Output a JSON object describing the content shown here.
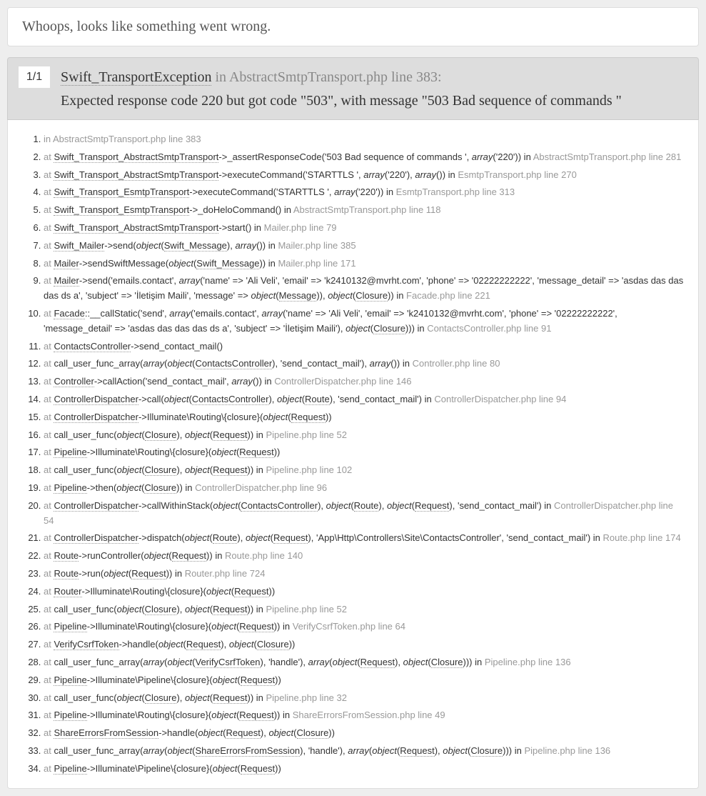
{
  "whoops_title": "Whoops, looks like something went wrong.",
  "counter": "1/1",
  "exception": {
    "name": "Swift_TransportException",
    "in_word": "in",
    "location": "AbstractSmtpTransport.php line 383",
    "message": "Expected response code 220 but got code \"503\", with message \"503 Bad sequence of commands \""
  },
  "t": {
    "in": "in ",
    "at": "at ",
    "obj": "object",
    "arr": "array",
    "l1_loc": "AbstractSmtpTransport.php line 383",
    "l2_cls": "Swift_Transport_AbstractSmtpTransport",
    "l2_m": "->_assertResponseCode('503 Bad sequence of commands ', ",
    "l2_a2": "('220')) in ",
    "l2_loc": "AbstractSmtpTransport.php line 281",
    "l3_cls": "Swift_Transport_AbstractSmtpTransport",
    "l3_m": "->executeCommand('STARTTLS ', ",
    "l3_a1": "('220'), ",
    "l3_a2": "()) in ",
    "l3_loc": "EsmtpTransport.php line 270",
    "l4_cls": "Swift_Transport_EsmtpTransport",
    "l4_m": "->executeCommand('STARTTLS ', ",
    "l4_a1": "('220')) in ",
    "l4_loc": "EsmtpTransport.php line 313",
    "l5_cls": "Swift_Transport_EsmtpTransport",
    "l5_m": "->_doHeloCommand() in ",
    "l5_loc": "AbstractSmtpTransport.php line 118",
    "l6_cls": "Swift_Transport_AbstractSmtpTransport",
    "l6_m": "->start() in ",
    "l6_loc": "Mailer.php line 79",
    "l7_cls": "Swift_Mailer",
    "l7_m": "->send(",
    "l7_o": "Swift_Message",
    "l7_t": "()) in ",
    "l7_loc": "Mailer.php line 385",
    "l8_cls": "Mailer",
    "l8_m": "->sendSwiftMessage(",
    "l8_o": "Swift_Message",
    "l8_t": ")) in ",
    "l8_loc": "Mailer.php line 171",
    "l9_cls": "Mailer",
    "l9_m": "->send('emails.contact', ",
    "l9_a": "('name' => 'Ali Veli', 'email' => 'k2410132@mvrht.com', 'phone' => '02222222222', 'message_detail' => 'asdas das das das ds a', 'subject' => 'İletişim Maili', 'message' => ",
    "l9_o1": "Message",
    "l9_t1": ")), ",
    "l9_o2": "Closure",
    "l9_t2": ")) in ",
    "l9_loc": "Facade.php line 221",
    "l10_cls": "Facade",
    "l10_m": "::__callStatic('send', ",
    "l10_a1": "('emails.contact', ",
    "l10_a2": "('name' => 'Ali Veli', 'email' => 'k2410132@mvrht.com', 'phone' => '02222222222', 'message_detail' => 'asdas das das das ds a', 'subject' => 'İletişim Maili'), ",
    "l10_o": "Closure",
    "l10_t": "))) in ",
    "l10_loc": "ContactsController.php line 91",
    "l11_cls": "ContactsController",
    "l11_m": "->send_contact_mail()",
    "l12_pre": "call_user_func_array(",
    "l12_o": "ContactsController",
    "l12_t1": "), 'send_contact_mail'), ",
    "l12_t2": "()) in ",
    "l12_loc": "Controller.php line 80",
    "l13_cls": "Controller",
    "l13_m": "->callAction('send_contact_mail', ",
    "l13_t": "()) in ",
    "l13_loc": "ControllerDispatcher.php line 146",
    "l14_cls": "ControllerDispatcher",
    "l14_m": "->call(",
    "l14_o1": "ContactsController",
    "l14_t1": "), ",
    "l14_o2": "Route",
    "l14_t2": "), 'send_contact_mail') in ",
    "l14_loc": "ControllerDispatcher.php line 94",
    "l15_cls": "ControllerDispatcher",
    "l15_m": "->Illuminate\\Routing\\{closure}(",
    "l15_o": "Request",
    "l15_t": "))",
    "l16_pre": "call_user_func(",
    "l16_o1": "Closure",
    "l16_o2": "Request",
    "l16_t": ")) in ",
    "l16_loc": "Pipeline.php line 52",
    "l17_cls": "Pipeline",
    "l17_m": "->Illuminate\\Routing\\{closure}(",
    "l17_o": "Request",
    "l17_t": "))",
    "l18_pre": "call_user_func(",
    "l18_o1": "Closure",
    "l18_o2": "Request",
    "l18_t": ")) in ",
    "l18_loc": "Pipeline.php line 102",
    "l19_cls": "Pipeline",
    "l19_m": "->then(",
    "l19_o": "Closure",
    "l19_t": ")) in ",
    "l19_loc": "ControllerDispatcher.php line 96",
    "l20_cls": "ControllerDispatcher",
    "l20_m": "->callWithinStack(",
    "l20_o1": "ContactsController",
    "l20_o2": "Route",
    "l20_o3": "Request",
    "l20_t": "), 'send_contact_mail') in ",
    "l20_loc": "ControllerDispatcher.php line 54",
    "l21_cls": "ControllerDispatcher",
    "l21_m": "->dispatch(",
    "l21_o1": "Route",
    "l21_o2": "Request",
    "l21_t": "), 'App\\Http\\Controllers\\Site\\ContactsController', 'send_contact_mail') in ",
    "l21_loc": "Route.php line 174",
    "l22_cls": "Route",
    "l22_m": "->runController(",
    "l22_o": "Request",
    "l22_t": ")) in ",
    "l22_loc": "Route.php line 140",
    "l23_cls": "Route",
    "l23_m": "->run(",
    "l23_o": "Request",
    "l23_t": ")) in ",
    "l23_loc": "Router.php line 724",
    "l24_cls": "Router",
    "l24_m": "->Illuminate\\Routing\\{closure}(",
    "l24_o": "Request",
    "l24_t": "))",
    "l25_pre": "call_user_func(",
    "l25_o1": "Closure",
    "l25_o2": "Request",
    "l25_t": ")) in ",
    "l25_loc": "Pipeline.php line 52",
    "l26_cls": "Pipeline",
    "l26_m": "->Illuminate\\Routing\\{closure}(",
    "l26_o": "Request",
    "l26_t": ")) in ",
    "l26_loc": "VerifyCsrfToken.php line 64",
    "l27_cls": "VerifyCsrfToken",
    "l27_m": "->handle(",
    "l27_o1": "Request",
    "l27_o2": "Closure",
    "l27_t": "))",
    "l28_pre": "call_user_func_array(",
    "l28_o1": "VerifyCsrfToken",
    "l28_t1": "), 'handle'), ",
    "l28_o2": "Request",
    "l28_o3": "Closure",
    "l28_t2": "))) in ",
    "l28_loc": "Pipeline.php line 136",
    "l29_cls": "Pipeline",
    "l29_m": "->Illuminate\\Pipeline\\{closure}(",
    "l29_o": "Request",
    "l29_t": "))",
    "l30_pre": "call_user_func(",
    "l30_o1": "Closure",
    "l30_o2": "Request",
    "l30_t": ")) in ",
    "l30_loc": "Pipeline.php line 32",
    "l31_cls": "Pipeline",
    "l31_m": "->Illuminate\\Routing\\{closure}(",
    "l31_o": "Request",
    "l31_t": ")) in ",
    "l31_loc": "ShareErrorsFromSession.php line 49",
    "l32_cls": "ShareErrorsFromSession",
    "l32_m": "->handle(",
    "l32_o1": "Request",
    "l32_o2": "Closure",
    "l32_t": "))",
    "l33_pre": "call_user_func_array(",
    "l33_o1": "ShareErrorsFromSession",
    "l33_t1": "), 'handle'), ",
    "l33_o2": "Request",
    "l33_o3": "Closure",
    "l33_t2": "))) in ",
    "l33_loc": "Pipeline.php line 136",
    "l34_cls": "Pipeline",
    "l34_m": "->Illuminate\\Pipeline\\{closure}(",
    "l34_o": "Request",
    "l34_t": "))"
  }
}
